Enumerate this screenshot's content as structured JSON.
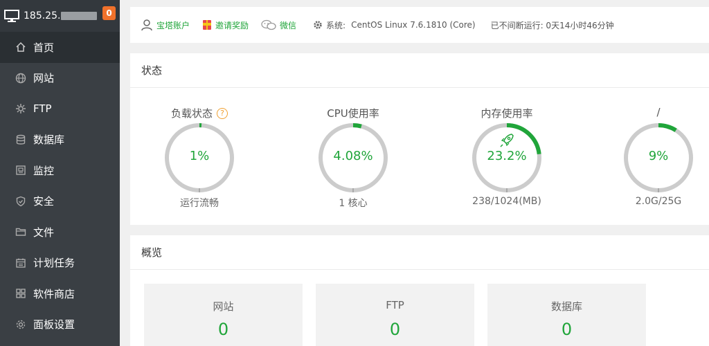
{
  "sidebar": {
    "server_ip": "185.25.",
    "badge": "0",
    "items": [
      {
        "label": "首页",
        "icon": "home-icon"
      },
      {
        "label": "网站",
        "icon": "globe-icon"
      },
      {
        "label": "FTP",
        "icon": "ftp-icon"
      },
      {
        "label": "数据库",
        "icon": "database-icon"
      },
      {
        "label": "监控",
        "icon": "monitor-icon"
      },
      {
        "label": "安全",
        "icon": "shield-icon"
      },
      {
        "label": "文件",
        "icon": "folder-icon"
      },
      {
        "label": "计划任务",
        "icon": "calendar-icon"
      },
      {
        "label": "软件商店",
        "icon": "apps-icon"
      },
      {
        "label": "面板设置",
        "icon": "gear-icon"
      }
    ]
  },
  "topbar": {
    "account": "宝塔账户",
    "invite": "邀请奖励",
    "wechat": "微信",
    "system_label": "系统:",
    "system_value": "CentOS Linux 7.6.1810 (Core)",
    "uptime": "已不间断运行: 0天14小时46分钟"
  },
  "status": {
    "title": "状态",
    "gauges": [
      {
        "title": "负载状态",
        "value": "1%",
        "sub": "运行流畅",
        "fraction": 0.01
      },
      {
        "title": "CPU使用率",
        "value": "4.08%",
        "sub": "1 核心",
        "fraction": 0.0408
      },
      {
        "title": "内存使用率",
        "value": "23.2%",
        "sub": "238/1024(MB)",
        "fraction": 0.232
      },
      {
        "title": "/",
        "value": "9%",
        "sub": "2.0G/25G",
        "fraction": 0.09
      }
    ]
  },
  "overview": {
    "title": "概览",
    "cards": [
      {
        "label": "网站",
        "value": "0"
      },
      {
        "label": "FTP",
        "value": "0"
      },
      {
        "label": "数据库",
        "value": "0"
      }
    ]
  },
  "colors": {
    "accent": "#20a53a",
    "sidebar_bg": "#3a3f44",
    "badge": "#f0712b",
    "ring_track": "#cccccc"
  }
}
